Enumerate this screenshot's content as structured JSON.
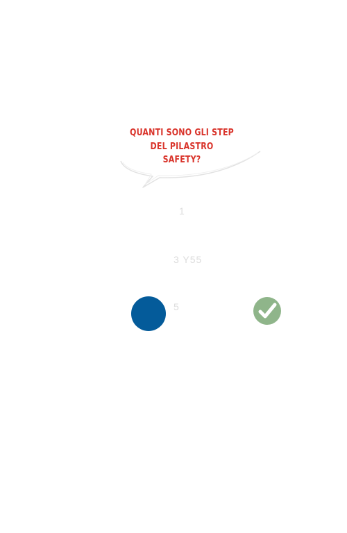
{
  "question": {
    "line1": "QUANTI SONO GLI STEP",
    "line2": "DEL PILASTRO",
    "line3": "SAFETY?"
  },
  "answers": [
    {
      "label": "1"
    },
    {
      "label": "3 Y55"
    },
    {
      "label": "5"
    }
  ],
  "icons": {
    "selected_marker": "blue-circle-icon",
    "correct_marker": "checkmark-icon"
  },
  "colors": {
    "question_text": "#d9342b",
    "selected_dot": "#045b9a",
    "correct_badge": "#8fb58a",
    "answer_text": "#dcdcdc"
  }
}
